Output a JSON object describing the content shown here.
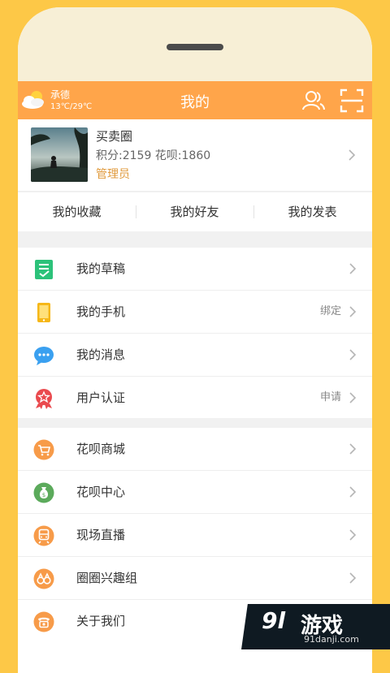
{
  "header": {
    "title": "我的",
    "weather_city": "承德",
    "weather_temp": "13℃/29℃",
    "accent": "#FFA54A"
  },
  "profile": {
    "name": "买卖圈",
    "stats": "积分:2159  花呗:1860",
    "role": "管理员"
  },
  "tabs": [
    "我的收藏",
    "我的好友",
    "我的发表"
  ],
  "menu_group1": [
    {
      "label": "我的草稿",
      "icon": "draft-icon",
      "extra": ""
    },
    {
      "label": "我的手机",
      "icon": "phone-icon",
      "extra": "绑定"
    },
    {
      "label": "我的消息",
      "icon": "message-icon",
      "extra": ""
    },
    {
      "label": "用户认证",
      "icon": "badge-icon",
      "extra": "申请"
    }
  ],
  "menu_group2": [
    {
      "label": "花呗商城",
      "icon": "cart-icon",
      "extra": ""
    },
    {
      "label": "花呗中心",
      "icon": "money-bag-icon",
      "extra": ""
    },
    {
      "label": "现场直播",
      "icon": "train-icon",
      "extra": ""
    },
    {
      "label": "圈圈兴趣组",
      "icon": "binoculars-icon",
      "extra": ""
    },
    {
      "label": "关于我们",
      "icon": "telephone-icon",
      "extra": ""
    }
  ],
  "watermark": {
    "logo": "9l",
    "text": "游戏",
    "sub": "91danji.com"
  }
}
